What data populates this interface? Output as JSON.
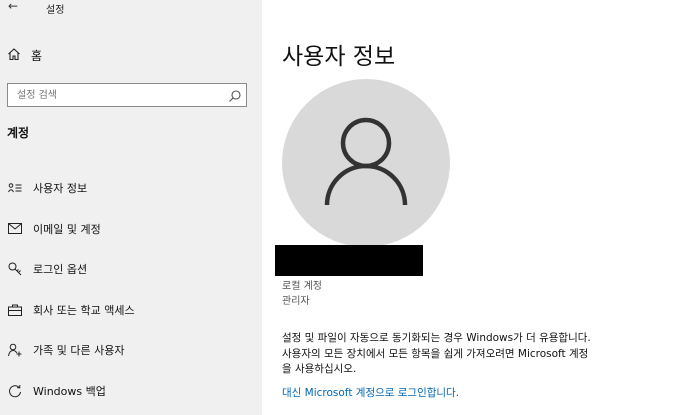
{
  "window": {
    "back_glyph": "←",
    "title": "설정"
  },
  "sidebar": {
    "home_label": "홈",
    "search_placeholder": "설정 검색",
    "section_heading": "계정",
    "items": [
      {
        "label": "사용자 정보",
        "icon": "person-card-icon"
      },
      {
        "label": "이메일 및 계정",
        "icon": "mail-icon"
      },
      {
        "label": "로그인 옵션",
        "icon": "key-icon"
      },
      {
        "label": "회사 또는 학교 액세스",
        "icon": "briefcase-icon"
      },
      {
        "label": "가족 및 다른 사용자",
        "icon": "add-person-icon"
      },
      {
        "label": "Windows 백업",
        "icon": "sync-icon"
      }
    ]
  },
  "main": {
    "title": "사용자 정보",
    "account_type": "로컬 계정",
    "account_role": "관리자",
    "sync_lines": [
      "설정 및 파일이 자동으로 동기화되는 경우 Windows가 더 유용합니다.",
      "사용자의 모든 장치에서 모든 항목을 쉽게 가져오려면 Microsoft 계정",
      "을 사용하십시오."
    ],
    "signin_link": "대신 Microsoft 계정으로 로그인합니다."
  },
  "colors": {
    "sidebar_bg": "#f0f0f0",
    "avatar_bg": "#d9d9d9",
    "link": "#0066b4"
  }
}
